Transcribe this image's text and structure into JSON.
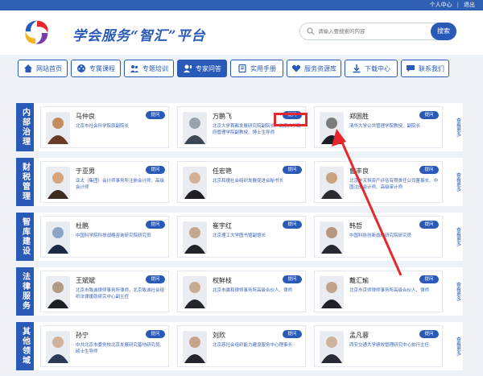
{
  "topbar": {
    "personal_center": "个人中心",
    "separator": "|",
    "logout": "退出"
  },
  "header": {
    "title": "学会服务“智汇”平台"
  },
  "search": {
    "placeholder": "请输入要搜索的内容",
    "button": "搜索"
  },
  "nav": [
    {
      "label": "网站首页",
      "icon": "home-icon"
    },
    {
      "label": "专属课程",
      "icon": "film-icon"
    },
    {
      "label": "专题培训",
      "icon": "people-icon"
    },
    {
      "label": "专家问答",
      "icon": "expert-icon",
      "active": true
    },
    {
      "label": "实用手册",
      "icon": "book-icon"
    },
    {
      "label": "服务资源库",
      "icon": "heart-icon"
    },
    {
      "label": "下载中心",
      "icon": "download-icon"
    },
    {
      "label": "联系我们",
      "icon": "chat-icon"
    }
  ],
  "ask_label": "提问",
  "more_label": "查看更多",
  "categories": [
    {
      "label": "内部治理",
      "experts": [
        {
          "name": "马仲良",
          "desc": "北京市社会科学院原副院长"
        },
        {
          "name": "万鹏飞",
          "desc": "北京大学首都发展研究院副院长、北京大学政府管理学院副教授、博士生导师"
        },
        {
          "name": "郑国胜",
          "desc": "清华大学公共管理学院教授、副院长"
        }
      ]
    },
    {
      "label": "财税管理",
      "experts": [
        {
          "name": "于亚男",
          "desc": "亚太（集团）会计师事务所注册会计师、高级会计师"
        },
        {
          "name": "任宏艳",
          "desc": "北京和捷社会组织发展促进会秘书长"
        },
        {
          "name": "曹丰良",
          "desc": "北京中天恒资产评估有限责任公司董事长、中国注册会计师、高级审计师"
        }
      ]
    },
    {
      "label": "智库建设",
      "experts": [
        {
          "name": "杜鹏",
          "desc": "中国科学院科技战略咨询研究院研究员"
        },
        {
          "name": "崔宇红",
          "desc": "北京理工大学图书馆副馆长"
        },
        {
          "name": "韩哲",
          "desc": "中国科协创新战略研究院研究员"
        }
      ]
    },
    {
      "label": "法律服务",
      "experts": [
        {
          "name": "王斌斌",
          "desc": "北京市致诚律师事务所律师，北京致诚社会组织法律援助研究中心副主任"
        },
        {
          "name": "权鲜枝",
          "desc": "北京市瀛和律师事务所高级合伙人、律师"
        },
        {
          "name": "戴汇瑜",
          "desc": "北京市京师律师事务所高级合伙人、律师"
        }
      ]
    },
    {
      "label": "其他领域",
      "experts": [
        {
          "name": "孙宁",
          "desc": "中共北京市委党校北京发展研究基地研究员、硕士生导师"
        },
        {
          "name": "刘欣",
          "desc": "北京慈社会组织能力建设服务中心理事长"
        },
        {
          "name": "孟凡蓉",
          "desc": "西安交通大学绩效管理研究中心执行主任"
        }
      ]
    }
  ]
}
